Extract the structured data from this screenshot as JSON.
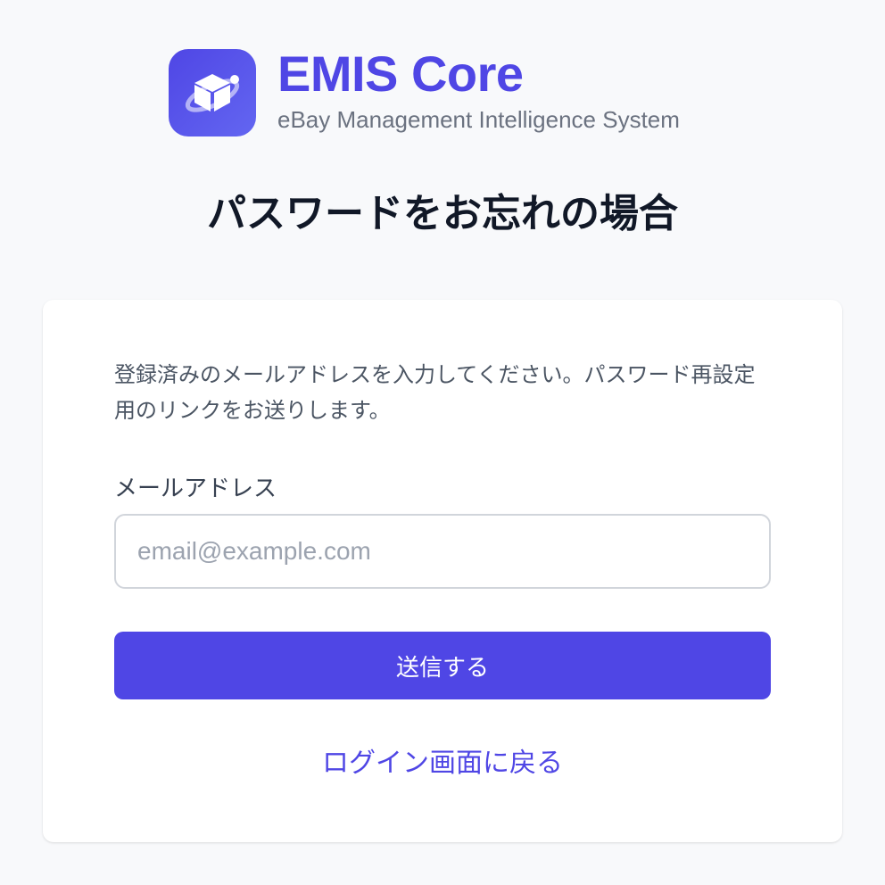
{
  "brand": {
    "logo_icon": "cube-orbit-icon",
    "title": "EMIS Core",
    "subtitle": "eBay Management Intelligence System"
  },
  "page": {
    "title": "パスワードをお忘れの場合"
  },
  "form": {
    "description": "登録済みのメールアドレスを入力してください。パスワード再設定用のリンクをお送りします。",
    "email_label": "メールアドレス",
    "email_placeholder": "email@example.com",
    "email_value": "",
    "submit_label": "送信する",
    "back_link_label": "ログイン画面に戻る"
  },
  "colors": {
    "accent": "#4f46e5",
    "background": "#f8f9fb",
    "card": "#ffffff",
    "muted_text": "#6b7280"
  }
}
